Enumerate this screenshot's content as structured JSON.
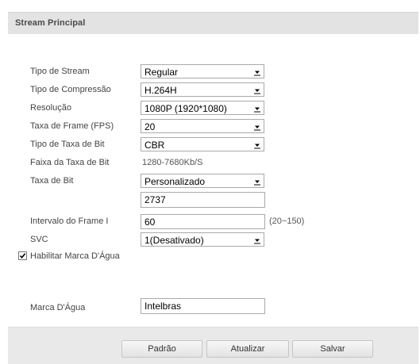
{
  "section": {
    "title": "Stream Principal"
  },
  "fields": {
    "stream_type": {
      "label": "Tipo de Stream",
      "value": "Regular"
    },
    "compression": {
      "label": "Tipo de Compressão",
      "value": "H.264H"
    },
    "resolution": {
      "label": "Resolução",
      "value": "1080P (1920*1080)"
    },
    "frame_rate": {
      "label": "Taxa de Frame (FPS)",
      "value": "20"
    },
    "bit_rate_type": {
      "label": "Tipo de Taxa de Bit",
      "value": "CBR"
    },
    "bit_rate_range": {
      "label": "Faixa da Taxa de Bit",
      "value": "1280-7680Kb/S"
    },
    "bit_rate": {
      "label": "Taxa de Bit",
      "value": "Personalizado",
      "custom_value": "2737"
    },
    "i_frame_interval": {
      "label": "Intervalo do Frame I",
      "value": "60",
      "range_hint": "(20~150)"
    },
    "svc": {
      "label": "SVC",
      "value": "1(Desativado)"
    },
    "watermark_enable": {
      "label": "Habilitar Marca D'Água",
      "checked": true
    },
    "watermark": {
      "label": "Marca D'Água",
      "value": "Intelbras"
    }
  },
  "buttons": {
    "default": "Padrão",
    "refresh": "Atualizar",
    "save": "Salvar"
  },
  "icons": {
    "dropdown": "dropdown-arrow-icon",
    "check": "checkmark-icon"
  }
}
